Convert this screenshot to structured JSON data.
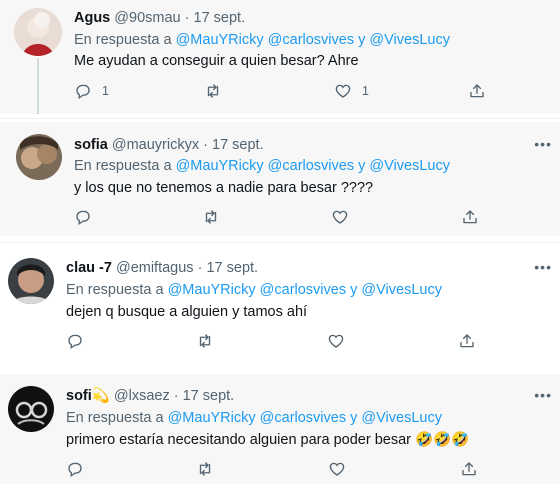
{
  "tweets": [
    {
      "name": "Agus",
      "handle": "@90smau",
      "dot": "·",
      "date": "17 sept.",
      "reply_prefix": "En respuesta a",
      "mentions": [
        "@MauYRicky",
        "@carlosvives",
        "@VivesLucy"
      ],
      "mention_join": "y",
      "text": "Me ayudan a conseguir a quien besar? Ahre",
      "counts": {
        "reply": "1",
        "retweet": "",
        "like": "1"
      }
    },
    {
      "name": "sofia",
      "handle": "@mauyrickyx",
      "dot": "·",
      "date": "17 sept.",
      "reply_prefix": "En respuesta a",
      "mentions": [
        "@MauYRicky",
        "@carlosvives",
        "@VivesLucy"
      ],
      "mention_join": "y",
      "text": "y los que no tenemos a nadie para besar ????",
      "counts": {
        "reply": "",
        "retweet": "",
        "like": ""
      }
    },
    {
      "name": "clau -7",
      "handle": "@emiftagus",
      "dot": "·",
      "date": "17 sept.",
      "reply_prefix": "En respuesta a",
      "mentions": [
        "@MauYRicky",
        "@carlosvives",
        "@VivesLucy"
      ],
      "mention_join": "y",
      "text": "dejen q busque a alguien y tamos ahí",
      "counts": {
        "reply": "",
        "retweet": "",
        "like": ""
      }
    },
    {
      "name": "sofi",
      "name_emoji": "💫",
      "handle": "@lxsaez",
      "dot": "·",
      "date": "17 sept.",
      "reply_prefix": "En respuesta a",
      "mentions": [
        "@MauYRicky",
        "@carlosvives",
        "@VivesLucy"
      ],
      "mention_join": "y",
      "text": "primero estaría necesitando alguien para poder besar",
      "text_emoji": "🤣🤣🤣",
      "counts": {
        "reply": "",
        "retweet": "",
        "like": ""
      }
    }
  ],
  "more_icon": "ellipsis-icon",
  "action_icons": [
    "reply-icon",
    "retweet-icon",
    "like-icon",
    "share-icon"
  ],
  "colors": {
    "accent": "#1d9bf0",
    "muted": "#536471",
    "text": "#0f1419",
    "gray_bg": "#f7f7f7"
  }
}
